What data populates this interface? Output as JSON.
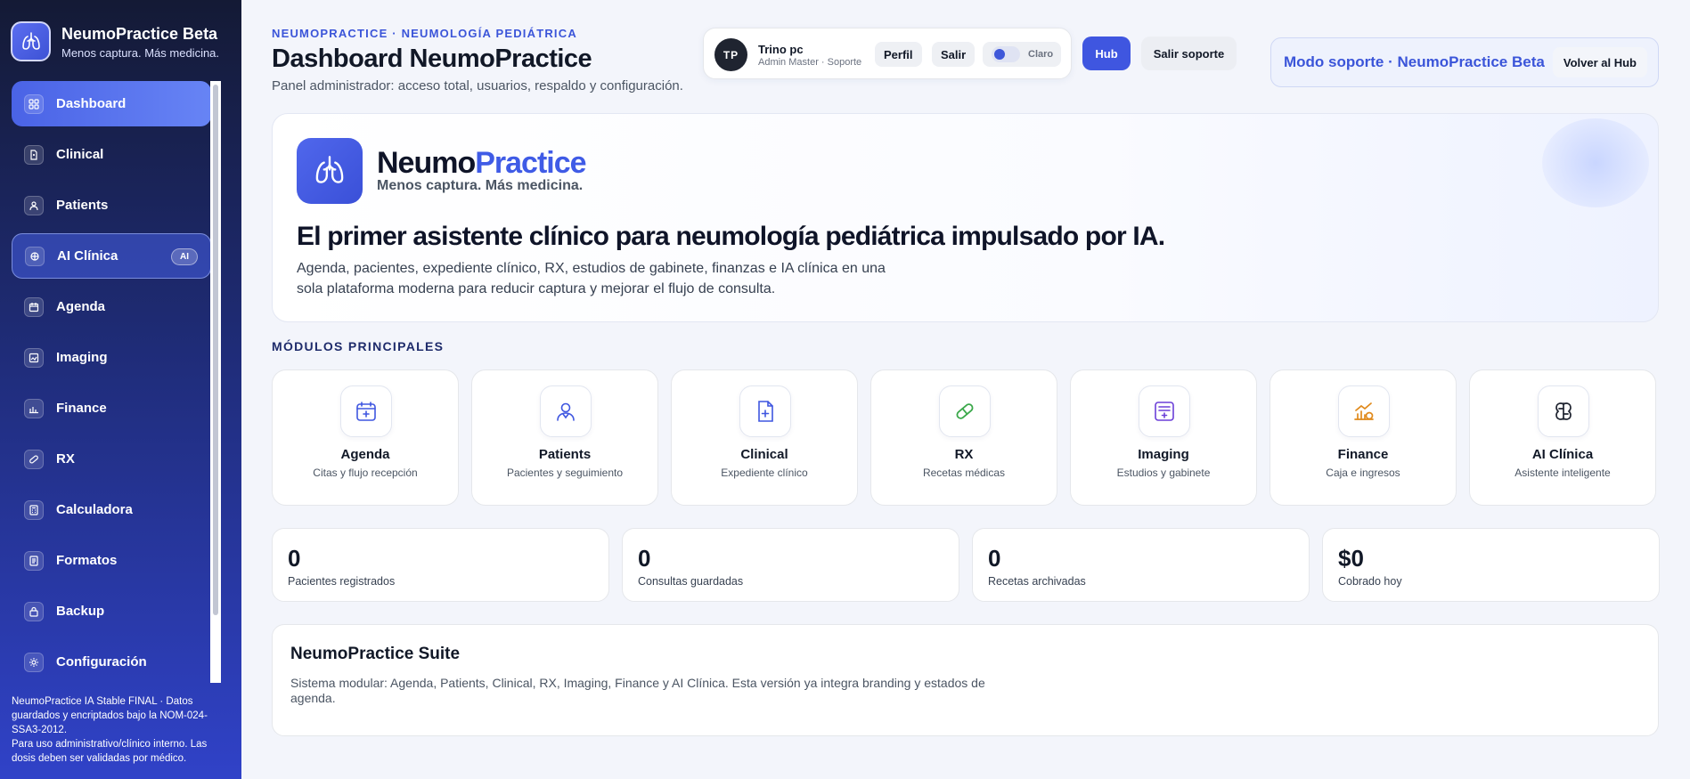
{
  "app": {
    "title": "NeumoPractice Beta",
    "tagline": "Menos captura. Más medicina."
  },
  "sidebar": {
    "items": [
      {
        "label": "Dashboard",
        "icon": "grid-icon",
        "active": true
      },
      {
        "label": "Clinical",
        "icon": "document-icon"
      },
      {
        "label": "Patients",
        "icon": "user-icon"
      },
      {
        "label": "AI Clínica",
        "icon": "brain-icon",
        "badge": "AI"
      },
      {
        "label": "Agenda",
        "icon": "calendar-icon"
      },
      {
        "label": "Imaging",
        "icon": "image-icon"
      },
      {
        "label": "Finance",
        "icon": "chart-icon"
      },
      {
        "label": "RX",
        "icon": "pill-icon"
      },
      {
        "label": "Calculadora",
        "icon": "calculator-icon"
      },
      {
        "label": "Formatos",
        "icon": "forms-icon"
      },
      {
        "label": "Backup",
        "icon": "backup-icon"
      },
      {
        "label": "Configuración",
        "icon": "gear-icon"
      }
    ],
    "footer_line1": "NeumoPractice IA Stable FINAL · Datos guardados y encriptados bajo la NOM-024-SSA3-2012.",
    "footer_line2": "Para uso administrativo/clínico interno. Las dosis deben ser validadas por médico."
  },
  "header": {
    "eyebrow": "NEUMOPRACTICE · NEUMOLOGÍA PEDIÁTRICA",
    "title": "Dashboard NeumoPractice",
    "subtitle": "Panel administrador: acceso total, usuarios, respaldo y configuración."
  },
  "user": {
    "initials": "TP",
    "name": "Trino pc",
    "role": "Admin Master · Soporte",
    "profile_label": "Perfil",
    "logout_label": "Salir",
    "theme_label": "Claro"
  },
  "actions": {
    "hub_label": "Hub",
    "exit_support_label": "Salir soporte"
  },
  "support": {
    "mode_text": "Modo soporte · NeumoPractice Beta",
    "back_label": "Volver al Hub"
  },
  "hero": {
    "brand_part1": "Neumo",
    "brand_part2": "Practice",
    "tagline": "Menos captura. Más medicina.",
    "headline": "El primer asistente clínico para neumología pediátrica impulsado por IA.",
    "description": "Agenda, pacientes, expediente clínico, RX, estudios de gabinete, finanzas e IA clínica en una sola plataforma moderna para reducir captura y mejorar el flujo de consulta."
  },
  "modules": {
    "title": "MÓDULOS PRINCIPALES",
    "items": [
      {
        "name": "Agenda",
        "desc": "Citas y flujo recepción",
        "icon": "calendar-icon"
      },
      {
        "name": "Patients",
        "desc": "Pacientes y seguimiento",
        "icon": "user-icon"
      },
      {
        "name": "Clinical",
        "desc": "Expediente clínico",
        "icon": "document-icon"
      },
      {
        "name": "RX",
        "desc": "Recetas médicas",
        "icon": "pill-icon"
      },
      {
        "name": "Imaging",
        "desc": "Estudios y gabinete",
        "icon": "image-icon"
      },
      {
        "name": "Finance",
        "desc": "Caja e ingresos",
        "icon": "chart-icon"
      },
      {
        "name": "AI Clínica",
        "desc": "Asistente inteligente",
        "icon": "brain-icon"
      }
    ]
  },
  "stats": [
    {
      "value": "0",
      "label": "Pacientes registrados"
    },
    {
      "value": "0",
      "label": "Consultas guardadas"
    },
    {
      "value": "0",
      "label": "Recetas archivadas"
    },
    {
      "value": "$0",
      "label": "Cobrado hoy"
    }
  ],
  "suite": {
    "title": "NeumoPractice Suite",
    "description": "Sistema modular: Agenda, Patients, Clinical, RX, Imaging, Finance y AI Clínica. Esta versión ya integra branding y estados de agenda."
  },
  "colors": {
    "accent": "#3f56e0",
    "sidebar_top": "#141a35",
    "sidebar_bottom": "#3042c8",
    "rx_green": "#3aa84a",
    "finance_orange": "#e08a1c"
  }
}
